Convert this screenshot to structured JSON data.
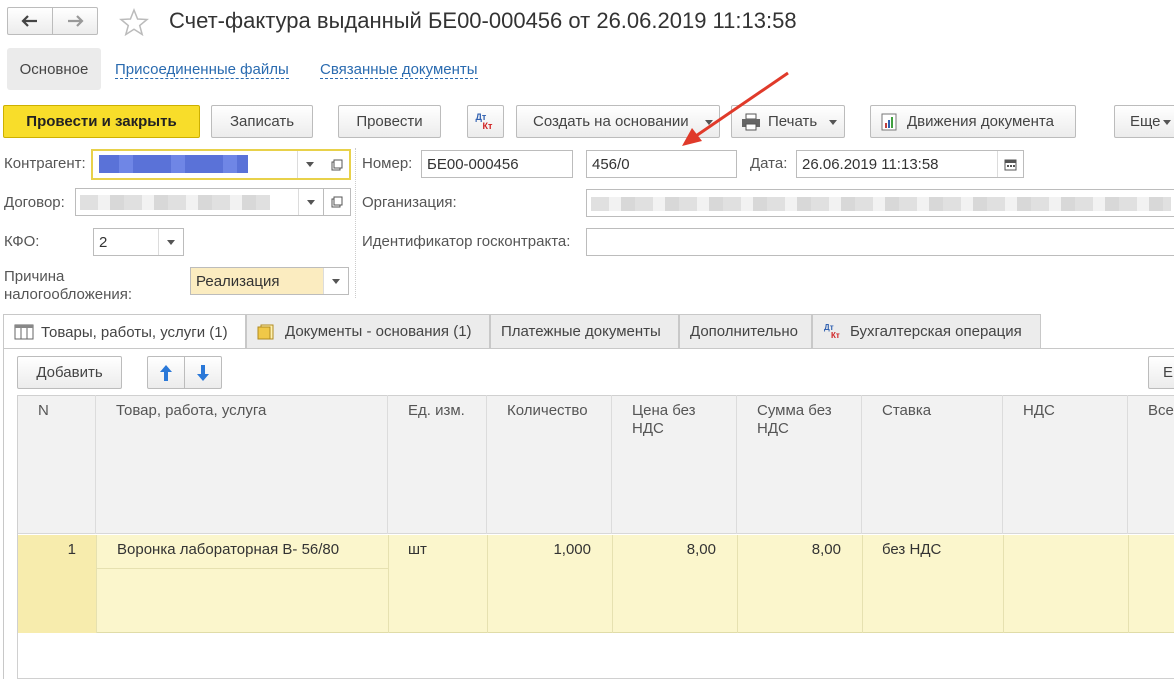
{
  "title": "Счет-фактура выданный БЕ00-000456 от 26.06.2019 11:13:58",
  "nav_tabs": [
    "Основное",
    "Присоединенные файлы",
    "Связанные документы"
  ],
  "toolbar": {
    "post_close": "Провести и закрыть",
    "save": "Записать",
    "post": "Провести",
    "dtkt_top": "Дт",
    "dtkt_bottom": "Кт",
    "create_based": "Создать на основании",
    "print": "Печать",
    "movements": "Движения документа",
    "more": "Еще"
  },
  "form": {
    "counterparty_label": "Контрагент:",
    "contract_label": "Договор:",
    "kfo_label": "КФО:",
    "kfo_value": "2",
    "tax_reason_label_1": "Причина",
    "tax_reason_label_2": "налогообложения:",
    "tax_reason_value": "Реализация",
    "number_label": "Номер:",
    "number_value": "БЕ00-000456",
    "number_suffix": "456/0",
    "date_label": "Дата:",
    "date_value": "26.06.2019 11:13:58",
    "org_label": "Организация:",
    "gov_contract_label": "Идентификатор госконтракта:"
  },
  "tabs": [
    "Товары, работы, услуги (1)",
    "Документы - основания (1)",
    "Платежные документы",
    "Дополнительно",
    "Бухгалтерская операция"
  ],
  "table_toolbar": {
    "add": "Добавить",
    "more_partial": "Е"
  },
  "table": {
    "headers": {
      "n": "N",
      "item": "Товар, работа, услуга",
      "unit": "Ед. изм.",
      "qty": "Количество",
      "price_1": "Цена без",
      "price_2": "НДС",
      "sum_1": "Сумма без",
      "sum_2": "НДС",
      "rate": "Ставка",
      "vat": "НДС",
      "total_partial": "Все"
    },
    "rows": [
      {
        "n": "1",
        "item": "Воронка лабораторная В- 56/80",
        "unit": "шт",
        "qty": "1,000",
        "price": "8,00",
        "sum": "8,00",
        "rate": "без НДС"
      }
    ]
  },
  "colors": {
    "accent": "#f8dd2a",
    "row_highlight": "#fbf6cc",
    "arrow": "#e03a2a"
  }
}
